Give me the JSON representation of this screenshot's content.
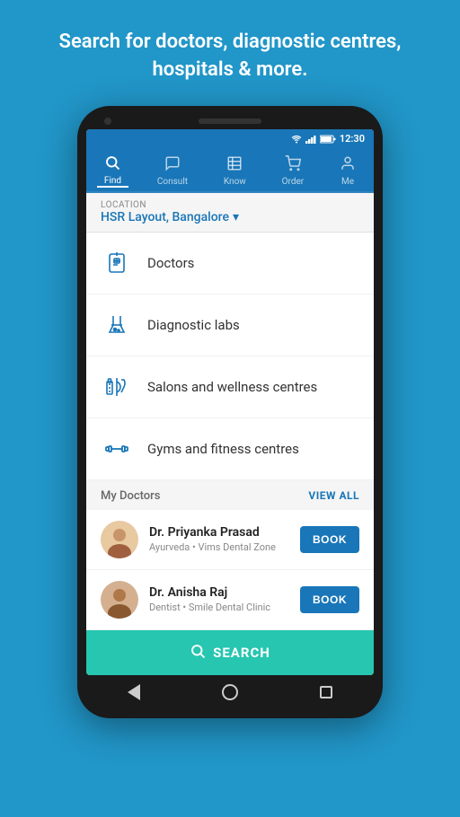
{
  "hero": {
    "text": "Search for doctors, diagnostic centres, hospitals & more."
  },
  "status_bar": {
    "time": "12:30"
  },
  "nav": {
    "items": [
      {
        "id": "find",
        "label": "Find",
        "active": true
      },
      {
        "id": "consult",
        "label": "Consult",
        "active": false
      },
      {
        "id": "know",
        "label": "Know",
        "active": false
      },
      {
        "id": "order",
        "label": "Order",
        "active": false
      },
      {
        "id": "me",
        "label": "Me",
        "active": false
      }
    ]
  },
  "location": {
    "label": "LOCATION",
    "value": "HSR Layout, Bangalore"
  },
  "menu_items": [
    {
      "id": "doctors",
      "label": "Doctors"
    },
    {
      "id": "diagnostic_labs",
      "label": "Diagnostic labs"
    },
    {
      "id": "salons",
      "label": "Salons and wellness centres"
    },
    {
      "id": "gyms",
      "label": "Gyms and fitness centres"
    }
  ],
  "my_doctors": {
    "title": "My Doctors",
    "view_all_label": "VIEW ALL",
    "doctors": [
      {
        "name": "Dr. Priyanka Prasad",
        "specialty": "Ayurveda • Vims Dental Zone",
        "book_label": "BOOK"
      },
      {
        "name": "Dr. Anisha Raj",
        "specialty": "Dentist • Smile Dental Clinic",
        "book_label": "BOOK"
      }
    ]
  },
  "search_bar": {
    "label": "SEARCH"
  }
}
